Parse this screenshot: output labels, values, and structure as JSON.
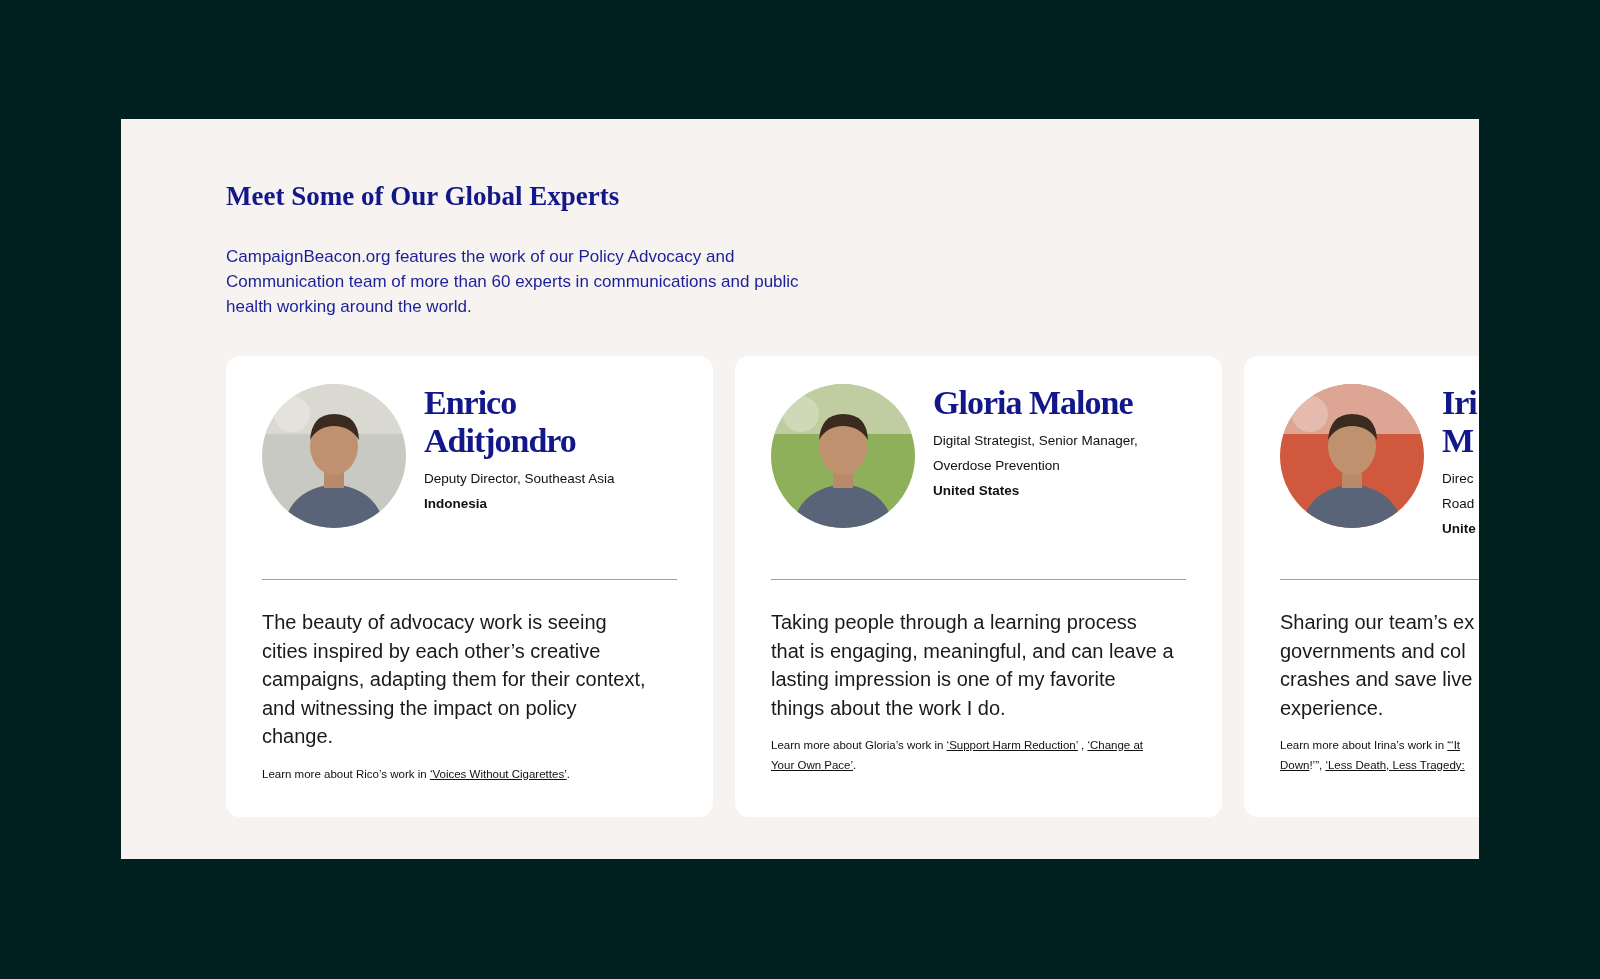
{
  "section": {
    "heading": "Meet Some of Our Global Experts",
    "intro": "CampaignBeacon.org features the work of our Policy Advocacy and Communication team of more than 60 experts in communications and public health working around the world."
  },
  "experts": [
    {
      "name_lines": [
        "Enrico",
        "Aditjondro"
      ],
      "role_lines": [
        "Deputy Director, Southeast Asia"
      ],
      "country": "Indonesia",
      "photo": {
        "kind": "picture"
      },
      "quote_lines": [
        "The beauty of advocacy work is seeing",
        "cities inspired by each other’s creative",
        "campaigns, adapting them for their context,",
        "and witnessing the impact on policy",
        "change."
      ],
      "learn_more": [
        [
          {
            "text": "Learn more about Rico’s work in ",
            "link": false
          },
          {
            "text": "‘Voices Without Cigarettes’",
            "link": true
          },
          {
            "text": ".",
            "link": false
          }
        ]
      ]
    },
    {
      "name_lines": [
        "Gloria Malone"
      ],
      "role_lines": [
        "Digital Strategist, Senior Manager,",
        "Overdose Prevention"
      ],
      "country": "United States",
      "photo": {
        "kind": "picture"
      },
      "quote_lines": [
        "Taking people through a learning process",
        "that is engaging, meaningful, and can leave a",
        "lasting impression is one of my favorite",
        "things about the work I do."
      ],
      "learn_more": [
        [
          {
            "text": "Learn more about Gloria’s work in ",
            "link": false
          },
          {
            "text": "‘Support Harm Reduction’",
            "link": true
          },
          {
            "text": " , ",
            "link": false
          },
          {
            "text": "‘Change at",
            "link": true
          }
        ],
        [
          {
            "text": "Your Own Pace’",
            "link": true
          },
          {
            "text": ".",
            "link": false
          }
        ]
      ]
    },
    {
      "name_lines": [
        "Iri",
        "M"
      ],
      "role_lines": [
        "Direc",
        "Road"
      ],
      "country": "Unite",
      "photo": {
        "kind": "picture"
      },
      "quote_lines": [
        "Sharing our team’s ex",
        "governments and col",
        "crashes and save live",
        "experience."
      ],
      "learn_more": [
        [
          {
            "text": "Learn more about Irina’s work in ",
            "link": false
          },
          {
            "text": "“‘It",
            "link": true
          }
        ],
        [
          {
            "text": "Down",
            "link": true
          },
          {
            "text": "!’”, ",
            "link": false
          },
          {
            "text": "‘Less Death, Less Tragedy:",
            "link": true
          }
        ]
      ]
    }
  ]
}
